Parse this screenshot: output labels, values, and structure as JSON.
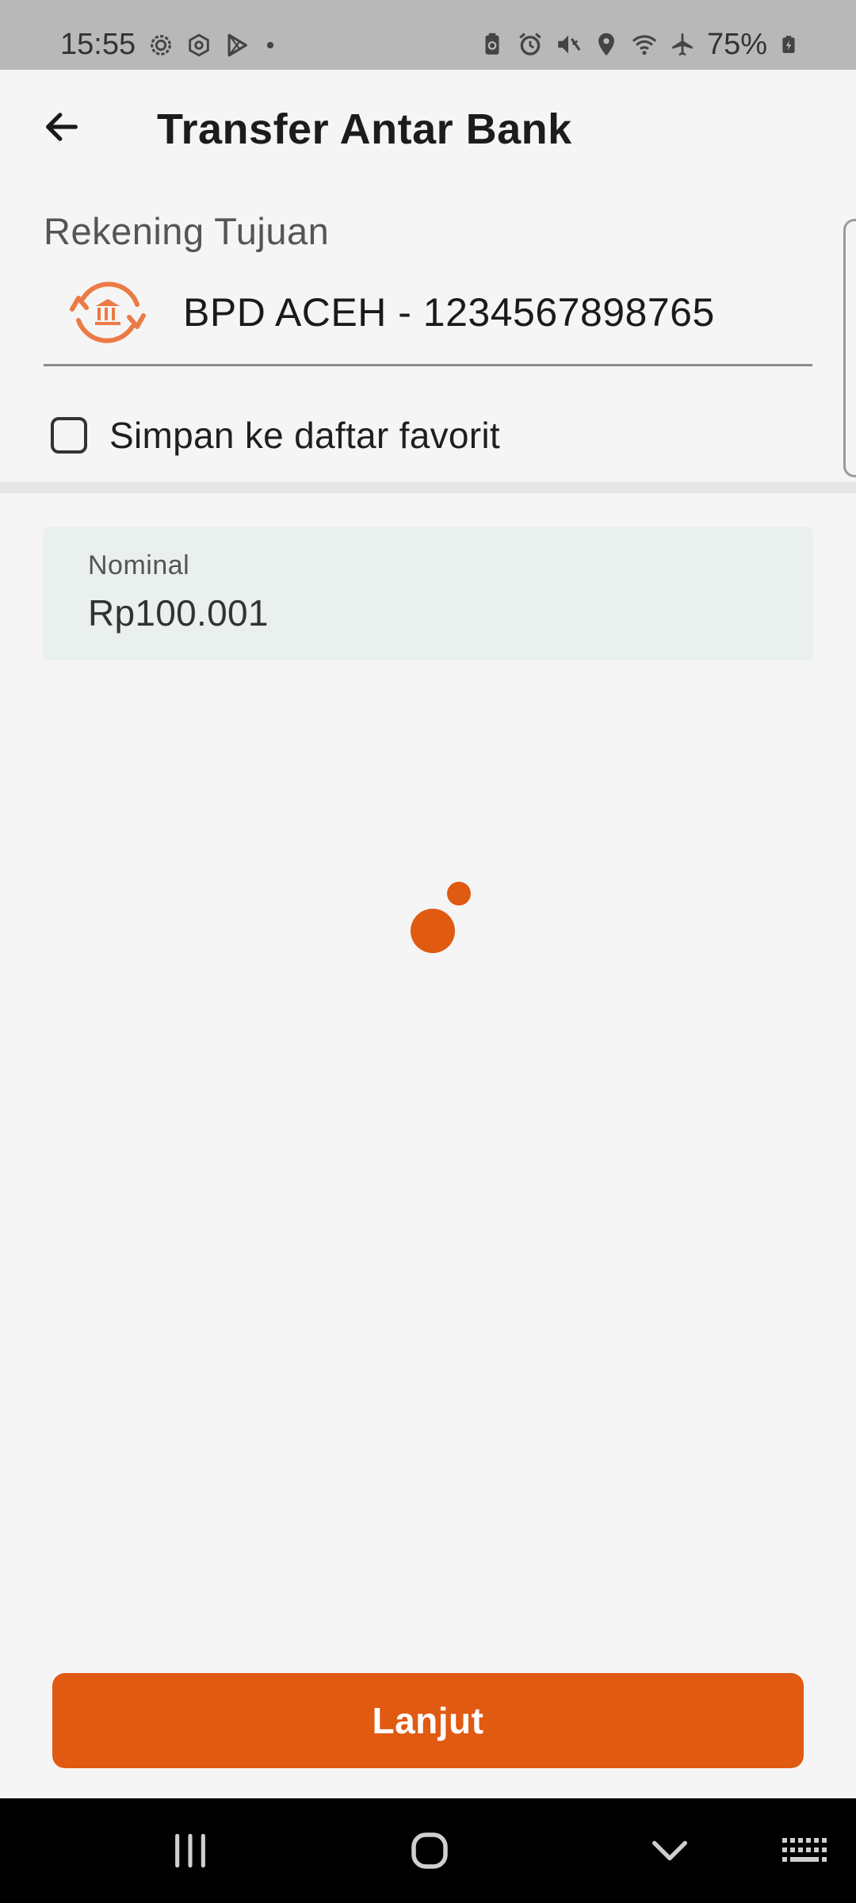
{
  "status_bar": {
    "time": "15:55",
    "battery": "75%",
    "left_icons": [
      "settings-gear-icon",
      "hexagon-gear-icon",
      "play-store-icon",
      "notification-dot-icon"
    ],
    "right_icons": [
      "battery-saver-icon",
      "alarm-icon",
      "mute-icon",
      "location-icon",
      "wifi-icon",
      "airplane-icon",
      "battery-charging-icon"
    ]
  },
  "header": {
    "title": "Transfer Antar Bank",
    "back_icon": "arrow-left-icon"
  },
  "destination": {
    "label": "Rekening Tujuan",
    "account": "BPD ACEH - 1234567898765",
    "icon": "bank-transfer-icon"
  },
  "favorite": {
    "label": "Simpan ke daftar favorit",
    "checked": false
  },
  "nominal": {
    "label": "Nominal",
    "value": "Rp100.001"
  },
  "loading": {
    "icon": "loading-dots-icon"
  },
  "actions": {
    "next_label": "Lanjut"
  },
  "colors": {
    "accent": "#e05a12",
    "icon_orange": "#ec7a45",
    "background": "#f5f5f5",
    "field_background": "#e9f0ee"
  },
  "nav_bar": {
    "icons": [
      "recent-apps-icon",
      "home-icon",
      "back-chevron-icon",
      "keyboard-icon"
    ]
  }
}
